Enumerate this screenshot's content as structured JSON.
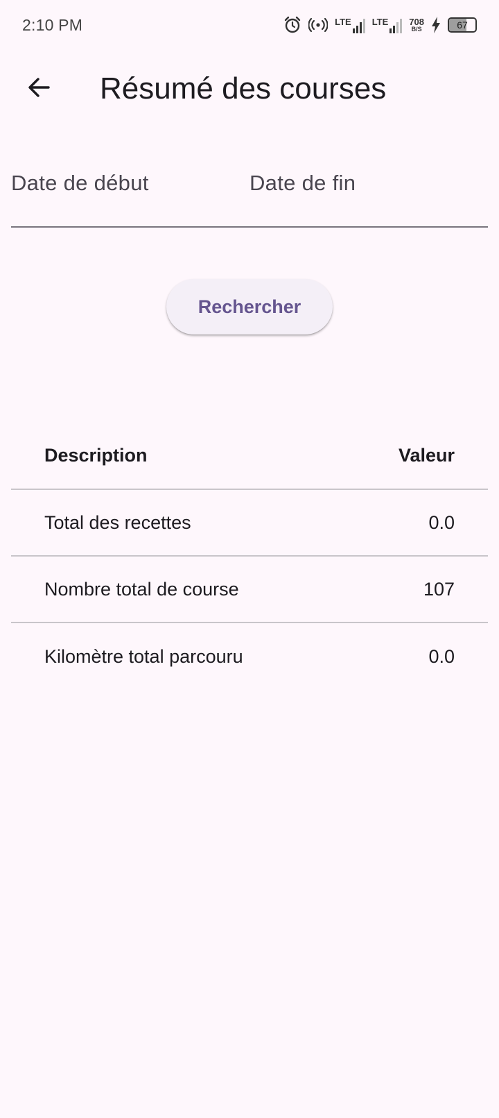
{
  "status_bar": {
    "time": "2:10 PM",
    "lte1": "LTE",
    "lte2": "LTE",
    "net_speed_value": "708",
    "net_speed_unit": "B/S",
    "battery_level": "67",
    "battery_fraction": 0.67,
    "icons": [
      "alarm-icon",
      "hotspot-icon",
      "lte-signal-icon",
      "lte-signal-icon",
      "charging-icon",
      "battery-icon"
    ]
  },
  "app_bar": {
    "title": "Résumé des courses",
    "back_icon": "arrow-left-icon"
  },
  "form": {
    "start_date_label": "Date de début",
    "end_date_label": "Date de fin",
    "search_label": "Rechercher"
  },
  "table": {
    "headers": [
      "Description",
      "Valeur"
    ],
    "rows": [
      {
        "description": "Total des recettes",
        "value": "0.0"
      },
      {
        "description": "Nombre total de course",
        "value": "107"
      },
      {
        "description": "Kilomètre total parcouru",
        "value": "0.0"
      }
    ]
  },
  "colors": {
    "background": "#fef7fc",
    "primary": "#65558f",
    "button_bg": "#f4eff7",
    "divider": "#c9c5ca",
    "outline": "#79747e"
  }
}
